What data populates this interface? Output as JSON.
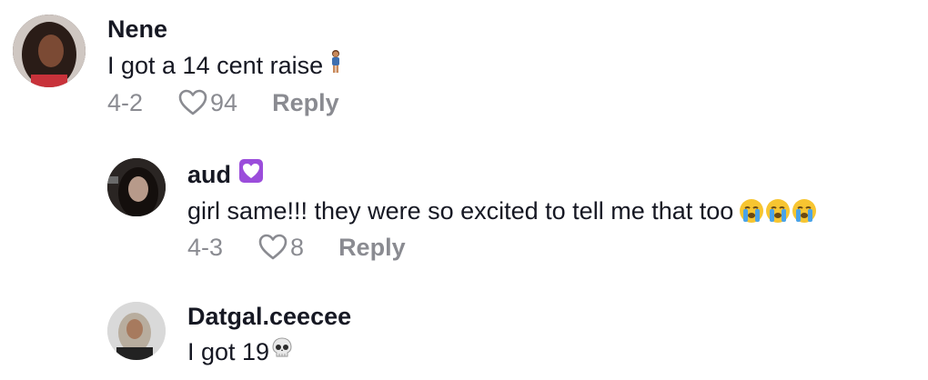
{
  "comments": [
    {
      "username": "Nene",
      "text": "I got a 14 cent raise",
      "emoji": "standing-girl",
      "date": "4-2",
      "likes": "94",
      "reply_label": "Reply"
    },
    {
      "username": "aud",
      "badge": "purple-heart",
      "text": "girl same!!! they were so excited to tell me that too",
      "emoji": "loudly-crying-face x3",
      "date": "4-3",
      "likes": "8",
      "reply_label": "Reply"
    },
    {
      "username": "Datgal.ceecee",
      "text": "I got 19",
      "emoji": "skull"
    }
  ]
}
